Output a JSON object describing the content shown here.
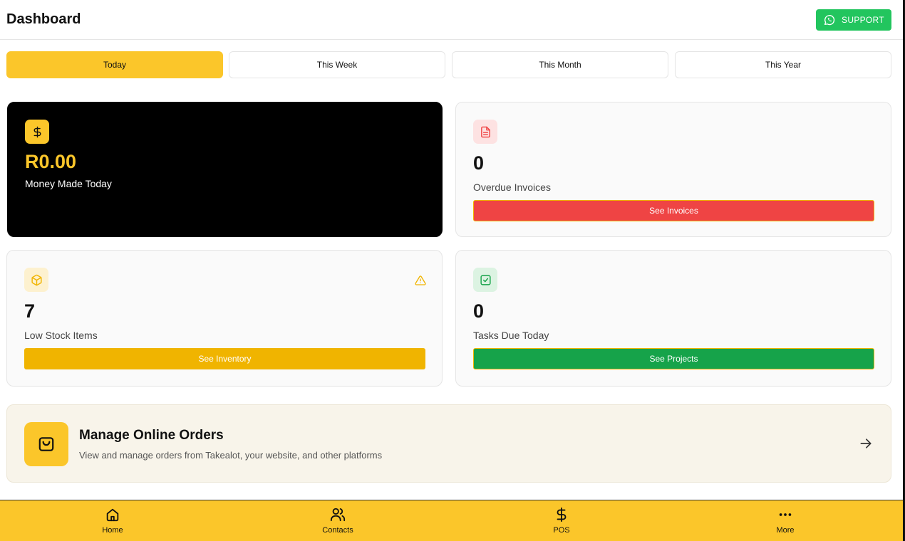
{
  "header": {
    "title": "Dashboard",
    "support_label": "SUPPORT"
  },
  "tabs": [
    {
      "label": "Today",
      "active": true
    },
    {
      "label": "This Week",
      "active": false
    },
    {
      "label": "This Month",
      "active": false
    },
    {
      "label": "This Year",
      "active": false
    }
  ],
  "cards": {
    "money": {
      "value": "R0.00",
      "label": "Money Made Today",
      "icon": "dollar-icon"
    },
    "invoices": {
      "value": "0",
      "label": "Overdue Invoices",
      "button": "See Invoices",
      "icon": "document-icon"
    },
    "stock": {
      "value": "7",
      "label": "Low Stock Items",
      "button": "See Inventory",
      "icon": "package-icon",
      "warning_icon": "warning-icon"
    },
    "tasks": {
      "value": "0",
      "label": "Tasks Due Today",
      "button": "See Projects",
      "icon": "checkbox-icon"
    }
  },
  "orders": {
    "title": "Manage Online Orders",
    "subtitle": "View and manage orders from Takealot, your website, and other platforms",
    "icon": "shopping-bag-icon"
  },
  "nav": [
    {
      "label": "Home",
      "icon": "home-icon"
    },
    {
      "label": "Contacts",
      "icon": "users-icon"
    },
    {
      "label": "POS",
      "icon": "dollar-icon"
    },
    {
      "label": "More",
      "icon": "more-icon"
    }
  ],
  "colors": {
    "accent": "#fbc62a",
    "support": "#22c55e",
    "invoices_button": "#ef4444",
    "inventory_button": "#f0b400",
    "projects_button": "#16a34a"
  }
}
